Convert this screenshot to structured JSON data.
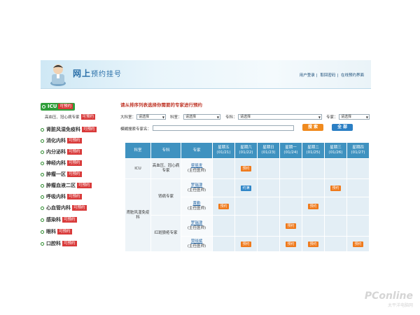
{
  "header": {
    "title": "网上",
    "title_sub": "预约挂号",
    "links": [
      "用户登录",
      "取回密码",
      "在线预约界面"
    ]
  },
  "sidebar": {
    "items": [
      {
        "name": "ICU",
        "button": "可预约"
      },
      {
        "name": "肾脏风湿免疫科",
        "button": "可预约"
      },
      {
        "name": "消化内科",
        "button": "可预约"
      },
      {
        "name": "内分泌科",
        "button": "可预约"
      },
      {
        "name": "神经内科",
        "button": "可预约"
      },
      {
        "name": "肿瘤一区",
        "button": "可预约"
      },
      {
        "name": "肿瘤血液二区",
        "button": "可预约"
      },
      {
        "name": "呼吸内科",
        "button": "可预约"
      },
      {
        "name": "心血管内科",
        "button": "可预约"
      },
      {
        "name": "感染科",
        "button": "可预约"
      },
      {
        "name": "眼科",
        "button": "可预约"
      },
      {
        "name": "口腔科",
        "button": "可预约"
      }
    ],
    "subitem": {
      "name": "高血压、冠心病专家",
      "button": "可预约"
    }
  },
  "main": {
    "prompt": "请从排序列表选择你需要的专家进行预约",
    "filters": {
      "big_dept_label": "大科室：",
      "dept_label": "科室：",
      "specialty_label": "专科：",
      "expert_label": "专家：",
      "select_placeholder": "请选择",
      "search_label": "模糊搜索专家名："
    },
    "buttons": {
      "search": "搜 索",
      "all": "全 部"
    },
    "table": {
      "headers": {
        "dept": "科室",
        "specialty": "专科",
        "expert": "专家",
        "days": [
          {
            "name": "星期五",
            "date": "(01/21)"
          },
          {
            "name": "星期六",
            "date": "(01/22)"
          },
          {
            "name": "星期日",
            "date": "(01/23)"
          },
          {
            "name": "星期一",
            "date": "(01/24)"
          },
          {
            "name": "星期二",
            "date": "(01/25)"
          },
          {
            "name": "星期三",
            "date": "(01/26)"
          },
          {
            "name": "星期四",
            "date": "(01/27)"
          }
        ]
      },
      "rows": {
        "icu_dept": "ICU",
        "icu_specialty": "高血压、冠心病专家",
        "r1_expert": "梁瑶发",
        "r1_title": "(主任医师)",
        "kidney_dept": "肾脏风湿免疫科",
        "kidney_spec": "肾病专家",
        "r2_expert": "罗瑞津",
        "r2_title": "(主任医师)",
        "r3_expert": "黄勤",
        "r3_title": "(主任医师)",
        "lupus_spec": "红斑狼疮专家",
        "r4_expert": "罗瑞津",
        "r4_title": "(主任医师)",
        "r5_expert": "贾晓斌",
        "r5_title": "(主任医师)"
      },
      "slot_labels": {
        "book": "预约",
        "full": "约满"
      }
    }
  },
  "watermark": {
    "brand": "PConline",
    "sub": "太平洋电脑网"
  },
  "colors": {
    "accent_blue": "#3f92c0",
    "book_orange": "#ef7a1c",
    "full_blue": "#2f86c8",
    "sidebar_red": "#d93a3a",
    "active_green": "#2f9e3a"
  }
}
